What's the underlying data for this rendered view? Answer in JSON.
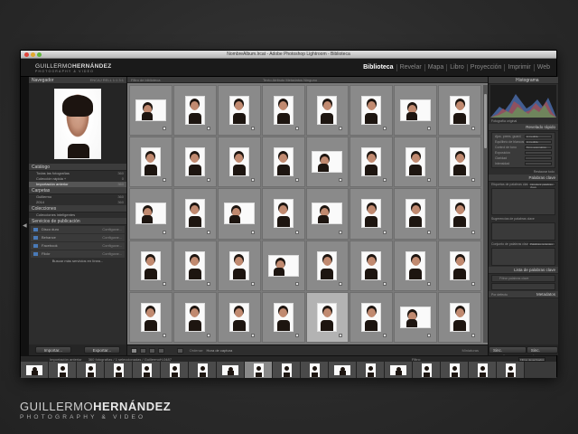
{
  "window": {
    "title": "NombreAlbum.lrcat - Adobe Photoshop Lightroom - Biblioteca"
  },
  "brand": {
    "first": "GUILLERMO",
    "last": "HERNÁNDEZ",
    "tagline": "PHOTOGRAPHY & VIDEO"
  },
  "modules": [
    "Biblioteca",
    "Revelar",
    "Mapa",
    "Libro",
    "Proyección",
    "Imprimir",
    "Web"
  ],
  "active_module": "Biblioteca",
  "left": {
    "navigator": {
      "label": "Navegador",
      "zoom": "ENCAJ  RELL  1:1  3:1"
    },
    "catalog": {
      "label": "Catálogo",
      "items": [
        {
          "label": "Todas las fotografías",
          "count": "360"
        },
        {
          "label": "Colección rápida +",
          "count": "0"
        },
        {
          "label": "Importación anterior",
          "count": "360"
        }
      ]
    },
    "folders": {
      "label": "Carpetas",
      "items": [
        {
          "label": "Guillermo",
          "count": "360"
        },
        {
          "label": "2014",
          "count": "360"
        }
      ]
    },
    "collections": {
      "label": "Colecciones",
      "items": [
        {
          "label": "Colecciones inteligentes",
          "count": ""
        }
      ]
    },
    "publish": {
      "label": "Servicios de publicación",
      "items": [
        {
          "label": "Disco duro",
          "action": "Configurar..."
        },
        {
          "label": "Behance",
          "action": "Configurar..."
        },
        {
          "label": "Facebook",
          "action": "Configurar..."
        },
        {
          "label": "Flickr",
          "action": "Configurar..."
        }
      ],
      "more": "Buscar más servicios en línea..."
    },
    "import_label": "Importar...",
    "export_label": "Exportar..."
  },
  "grid": {
    "filter_label": "Filtro de biblioteca",
    "tabs": "Texto   Atributo   Metadatos   Ninguno",
    "selected_index": 36,
    "cells": [
      "l",
      "p",
      "p",
      "p",
      "p",
      "p",
      "l",
      "p",
      "p",
      "p",
      "p",
      "p",
      "l",
      "p",
      "p",
      "p",
      "l",
      "p",
      "l",
      "p",
      "l",
      "p",
      "p",
      "p",
      "p",
      "p",
      "p",
      "l",
      "p",
      "p",
      "p",
      "p",
      "p",
      "p",
      "p",
      "p",
      "p",
      "p",
      "l",
      "p"
    ]
  },
  "toolbar": {
    "sort_label": "Ordenar:",
    "sort_value": "Hora de captura",
    "thumbs_label": "Miniaturas"
  },
  "right": {
    "histogram": "Histograma",
    "original": "Fotografía original",
    "quick_develop": "Revelado rápido",
    "rows": [
      {
        "label": "Ajus. prees. guard.",
        "value": "A medida"
      },
      {
        "label": "Equilibrio de blancos",
        "value": "A medida"
      },
      {
        "label": "Control de tono",
        "value": "Tono automático"
      },
      {
        "label": "Exposición",
        "value": ""
      },
      {
        "label": "Claridad",
        "value": ""
      },
      {
        "label": "Intensidad",
        "value": ""
      }
    ],
    "reset": "Restaurar todo",
    "keywords": "Palabras clave",
    "kw_tags": "Etiquetas de palabras clave",
    "kw_tags_value": "Introducir palabras clave",
    "kw_suggest": "Sugerencias de palabras clave",
    "kw_set": "Conjunto de palabras clave",
    "kw_set_value": "Palabras recientes",
    "kw_list": "Lista de palabras clave",
    "kw_filter": "Filtrar palabras clave",
    "metadata": "Metadatos",
    "metadata_preset": "Por defecto",
    "sync_meta": "Sinc. metadatos",
    "sync_settings": "Sinc. ajustes"
  },
  "filmstrip": {
    "source": "Importación anterior",
    "info": "360 fotografías / 1 seleccionadas / GuillermoH-0487",
    "filter_label": "Filtro:",
    "filter_value": "Filtros desactivados",
    "selected_index": 8,
    "cells": [
      "l",
      "p",
      "p",
      "p",
      "p",
      "p",
      "p",
      "l",
      "p",
      "p",
      "p",
      "l",
      "p",
      "l",
      "p",
      "p",
      "p",
      "p"
    ]
  }
}
